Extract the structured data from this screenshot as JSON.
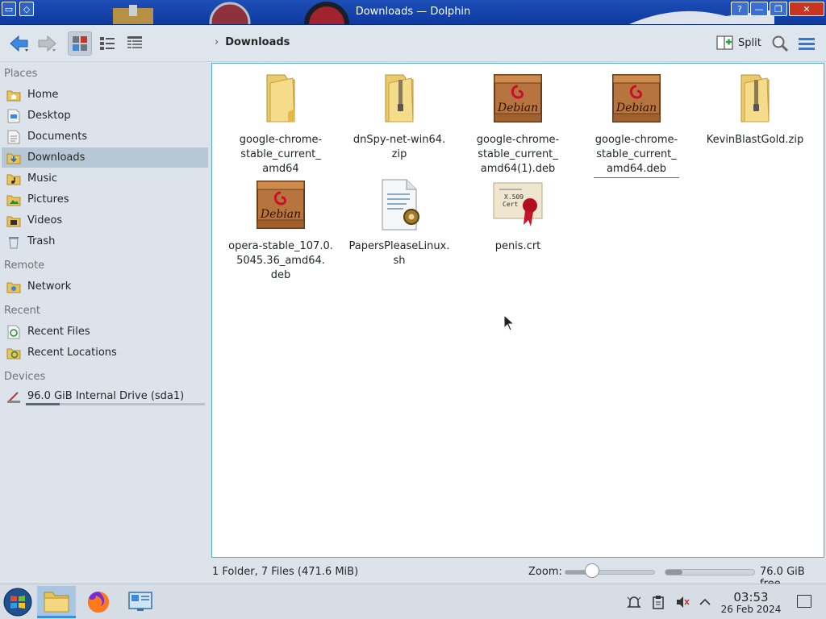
{
  "window": {
    "title": "Downloads — Dolphin"
  },
  "toolbar": {
    "back_icon": "back-arrow-icon",
    "forward_icon": "forward-arrow-icon",
    "breadcrumb_current": "Downloads",
    "split_label": "Split"
  },
  "sidebar": {
    "sections": {
      "places": "Places",
      "remote": "Remote",
      "recent": "Recent",
      "devices": "Devices"
    },
    "places": [
      {
        "label": "Home",
        "icon": "home-icon"
      },
      {
        "label": "Desktop",
        "icon": "desktop-icon"
      },
      {
        "label": "Documents",
        "icon": "documents-icon"
      },
      {
        "label": "Downloads",
        "icon": "downloads-icon",
        "active": true
      },
      {
        "label": "Music",
        "icon": "music-icon"
      },
      {
        "label": "Pictures",
        "icon": "pictures-icon"
      },
      {
        "label": "Videos",
        "icon": "videos-icon"
      },
      {
        "label": "Trash",
        "icon": "trash-icon"
      }
    ],
    "remote": [
      {
        "label": "Network",
        "icon": "network-icon"
      }
    ],
    "recent": [
      {
        "label": "Recent Files",
        "icon": "recent-files-icon"
      },
      {
        "label": "Recent Locations",
        "icon": "recent-locations-icon"
      }
    ],
    "devices": [
      {
        "label": "96.0 GiB Internal Drive (sda1)",
        "icon": "drive-icon",
        "used_fraction": 0.19
      }
    ]
  },
  "files": [
    {
      "name": "google-chrome-stable_current_amd64",
      "type": "folder"
    },
    {
      "name": "dnSpy-net-win64.zip",
      "type": "zip"
    },
    {
      "name": "google-chrome-stable_current_amd64(1).deb",
      "type": "deb"
    },
    {
      "name": "google-chrome-stable_current_amd64.deb",
      "type": "deb"
    },
    {
      "name": "KevinBlastGold.zip",
      "type": "zip"
    },
    {
      "name": "opera-stable_107.0.5045.36_amd64.deb",
      "type": "deb"
    },
    {
      "name": "PapersPleaseLinux.sh",
      "type": "script"
    },
    {
      "name": "penis.crt",
      "type": "certificate"
    }
  ],
  "file_lines": [
    [
      "google-chrome-",
      "stable_current_",
      "amd64"
    ],
    [
      "dnSpy-net-win64.",
      "zip"
    ],
    [
      "google-chrome-",
      "stable_current_",
      "amd64(1).deb"
    ],
    [
      "google-chrome-",
      "stable_current_",
      "amd64.deb"
    ],
    [
      "KevinBlastGold.zip"
    ],
    [
      "opera-stable_107.0.",
      "5045.36_amd64.",
      "deb"
    ],
    [
      "PapersPleaseLinux.",
      "sh"
    ],
    [
      "penis.crt"
    ]
  ],
  "deb_label": "Debian",
  "status": {
    "summary": "1 Folder, 7 Files (471.6 MiB)",
    "zoom_label": "Zoom:",
    "zoom_fraction": 0.3,
    "free_space": "76.0 GiB free",
    "used_fraction": 0.19
  },
  "taskbar": {
    "time": "03:53",
    "date": "26 Feb 2024"
  },
  "colors": {
    "accent": "#3d8ee0",
    "selection": "#b6c7d6",
    "titlebar": "#1d4fb6"
  }
}
